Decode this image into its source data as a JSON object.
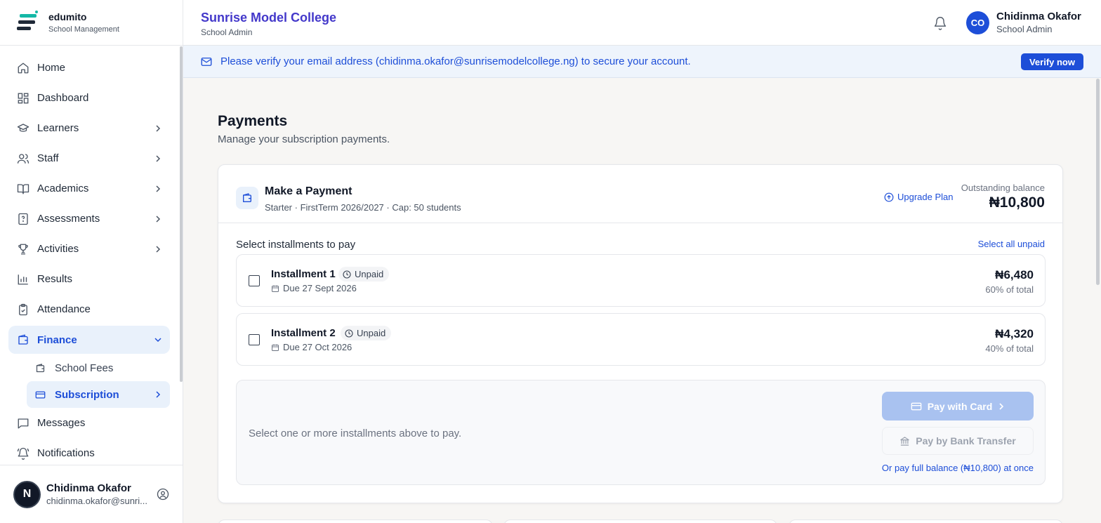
{
  "brand": {
    "name": "edumito",
    "subtitle": "School Management"
  },
  "sidebar": {
    "items": [
      {
        "label": "Home",
        "icon": "home-icon",
        "has_chevron": false
      },
      {
        "label": "Dashboard",
        "icon": "dashboard-icon",
        "has_chevron": false
      },
      {
        "label": "Learners",
        "icon": "graduation-cap-icon",
        "has_chevron": true
      },
      {
        "label": "Staff",
        "icon": "users-icon",
        "has_chevron": true
      },
      {
        "label": "Academics",
        "icon": "book-open-icon",
        "has_chevron": true
      },
      {
        "label": "Assessments",
        "icon": "file-question-icon",
        "has_chevron": true
      },
      {
        "label": "Activities",
        "icon": "trophy-icon",
        "has_chevron": true
      },
      {
        "label": "Results",
        "icon": "bar-chart-icon",
        "has_chevron": false
      },
      {
        "label": "Attendance",
        "icon": "clipboard-check-icon",
        "has_chevron": false
      },
      {
        "label": "Finance",
        "icon": "wallet-icon",
        "expanded": true
      },
      {
        "label": "Messages",
        "icon": "message-square-icon",
        "has_chevron": false
      },
      {
        "label": "Notifications",
        "icon": "bell-ring-icon",
        "has_chevron": false
      }
    ],
    "finance_sub": [
      {
        "label": "School Fees",
        "icon": "wallet-icon"
      },
      {
        "label": "Subscription",
        "icon": "credit-card-icon",
        "current": true
      }
    ],
    "user": {
      "initial": "N",
      "name": "Chidinma Okafor",
      "email": "chidinma.okafor@sunri..."
    }
  },
  "header": {
    "school_name": "Sunrise Model College",
    "school_role": "School Admin",
    "user_initials": "CO",
    "user_name": "Chidinma Okafor",
    "user_role": "School Admin"
  },
  "banner": {
    "text": "Please verify your email address (chidinma.okafor@sunrisemodelcollege.ng) to secure your account.",
    "button": "Verify now"
  },
  "page": {
    "title": "Payments",
    "subtitle": "Manage your subscription payments."
  },
  "payment_card": {
    "title": "Make a Payment",
    "subtitle": "Starter · FirstTerm 2026/2027 · Cap: 50 students",
    "upgrade_label": "Upgrade Plan",
    "outstanding_label": "Outstanding balance",
    "outstanding_value": "₦10,800",
    "select_label": "Select installments to pay",
    "select_all_label": "Select all unpaid",
    "installments": [
      {
        "name": "Installment 1",
        "status": "Unpaid",
        "due": "Due 27 Sept 2026",
        "amount": "₦6,480",
        "percent": "60% of total",
        "checked": false
      },
      {
        "name": "Installment 2",
        "status": "Unpaid",
        "due": "Due 27 Oct 2026",
        "amount": "₦4,320",
        "percent": "40% of total",
        "checked": false
      }
    ],
    "pay_hint": "Select one or more installments above to pay.",
    "pay_card_label": "Pay with Card",
    "pay_bank_label": "Pay by Bank Transfer",
    "pay_full_label": "Or pay full balance (₦10,800) at once"
  },
  "colors": {
    "accent": "#1d4ed8",
    "school_name": "#4338ca",
    "active_bg": "#e9f1fb",
    "banner_bg": "#eef4fc",
    "disabled_primary": "#a9c2f0"
  }
}
